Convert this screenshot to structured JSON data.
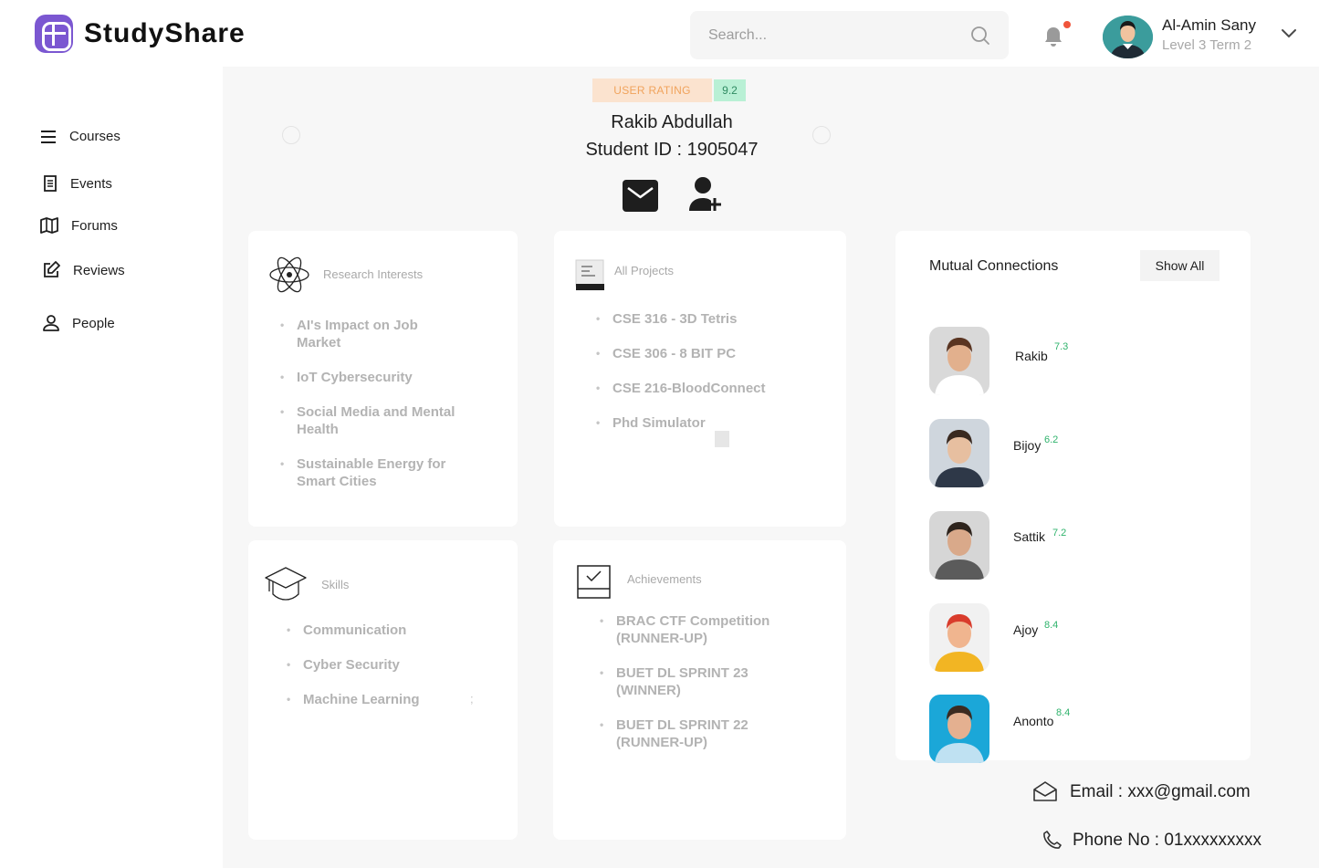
{
  "brand": {
    "name": "StudySharе"
  },
  "header": {
    "search_placeholder": "Search...",
    "user_name": "Al-Amin Sany",
    "user_level": "Level 3 Term 2"
  },
  "sidebar": {
    "items": [
      {
        "label": "Courses",
        "icon": "menu-icon"
      },
      {
        "label": "Events",
        "icon": "document-icon"
      },
      {
        "label": "Forums",
        "icon": "map-icon"
      },
      {
        "label": "Reviews",
        "icon": "edit-icon"
      },
      {
        "label": "People",
        "icon": "person-icon"
      }
    ]
  },
  "profile": {
    "rating_label": "USER RATING",
    "rating_value": "9.2",
    "name": "Rakib Abdullah",
    "student_id": "Student ID : 1905047"
  },
  "research": {
    "title": "Research Interests",
    "items": [
      "AI's Impact on Job Market",
      "IoT Cybersecurity",
      "Social Media and Mental Health",
      "Sustainable Energy for Smart Cities"
    ]
  },
  "projects": {
    "title": "All Projects",
    "items": [
      "CSE 316 - 3D Tetris",
      "CSE 306 - 8 BIT PC",
      "CSE 216-BloodConnect",
      "Phd Simulator"
    ]
  },
  "skills": {
    "title": "Skills",
    "items": [
      "Communication",
      "Cyber Security",
      "Machine Learning"
    ],
    "stray_mark": ";"
  },
  "achievements": {
    "title": "Achievements",
    "items": [
      "BRAC CTF Competition (RUNNER-UP)",
      "BUET DL SPRINT 23 (WINNER)",
      "BUET DL SPRINT 22 (RUNNER-UP)"
    ]
  },
  "mutual": {
    "title": "Mutual Connections",
    "show_all": "Show All",
    "people": [
      {
        "name": "Rakib",
        "score": "7.3",
        "bg": "#d9d9d9",
        "shirt": "#ffffff",
        "skin": "#e2b08d",
        "hair": "#5a3522"
      },
      {
        "name": "Bijoy",
        "score": "6.2",
        "bg": "#cfd6dd",
        "shirt": "#2e3848",
        "skin": "#e7bfa0",
        "hair": "#3a2a20"
      },
      {
        "name": "Sattik",
        "score": "7.2",
        "bg": "#d6d6d6",
        "shirt": "#5b5b5b",
        "skin": "#d9a98a",
        "hair": "#2e241d"
      },
      {
        "name": "Ajoy",
        "score": "8.4",
        "bg": "#f1f1f1",
        "shirt": "#f2b523",
        "skin": "#f0b58f",
        "hair": "#d93c2c"
      },
      {
        "name": "Anonto",
        "score": "8.4",
        "bg": "#1ba7d8",
        "shirt": "#bfe1f2",
        "skin": "#e4b090",
        "hair": "#3b2a20"
      }
    ]
  },
  "contact": {
    "email": "Email : xxx@gmail.com",
    "phone": "Phone No : 01xxxxxxxxx"
  }
}
